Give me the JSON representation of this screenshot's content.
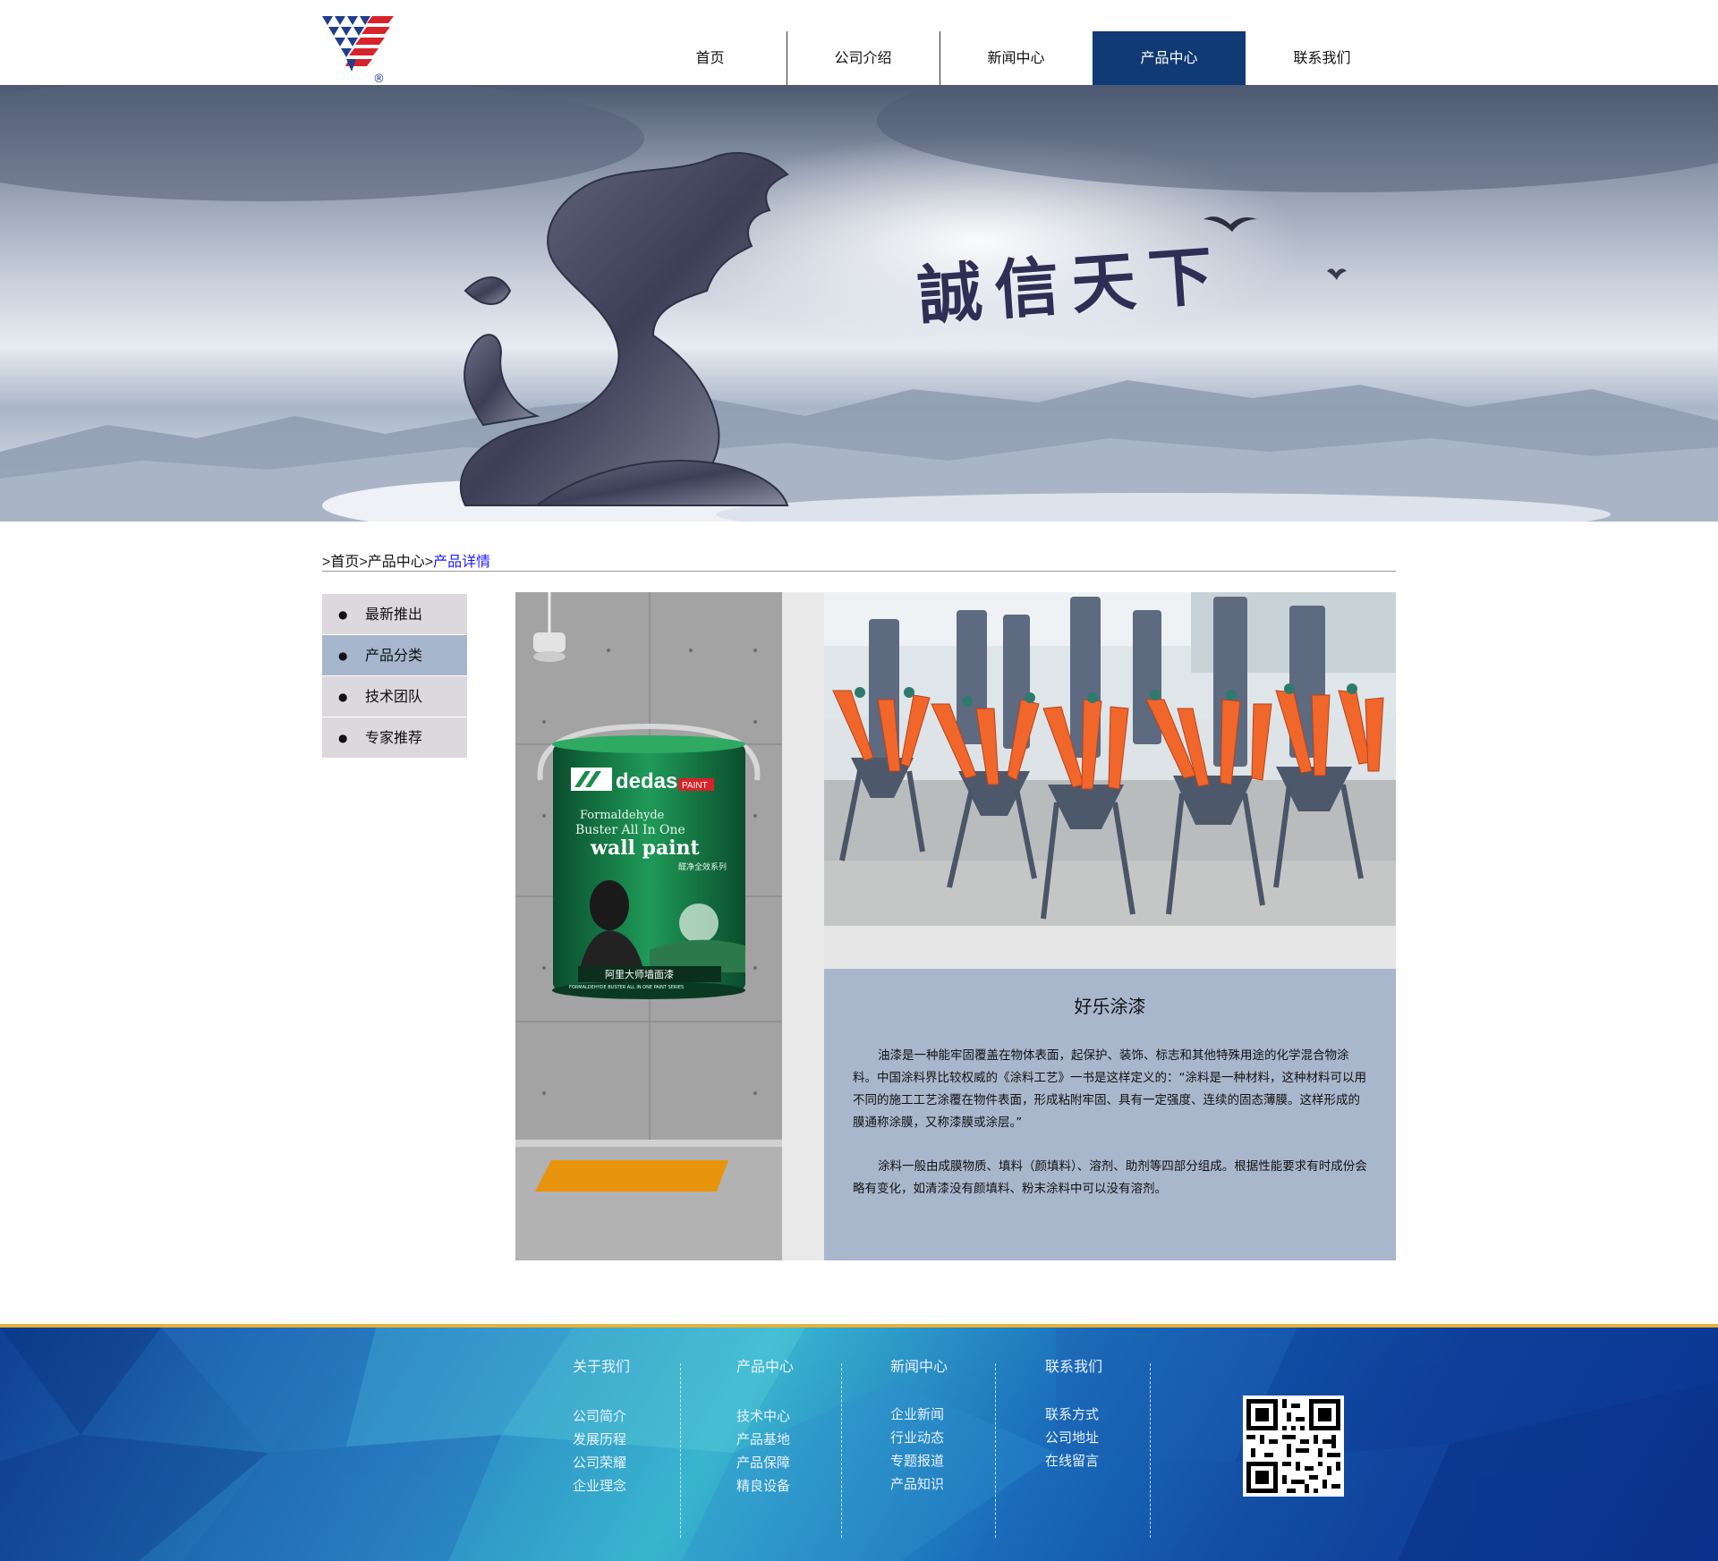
{
  "header": {
    "logo_mark": "®",
    "nav": [
      {
        "label": "首页",
        "active": false
      },
      {
        "label": "公司介绍",
        "active": false
      },
      {
        "label": "新闻中心",
        "active": false
      },
      {
        "label": "产品中心",
        "active": true
      },
      {
        "label": "联系我们",
        "active": false
      }
    ]
  },
  "banner": {
    "slogan": "誠信天下"
  },
  "breadcrumb": {
    "items": [
      "首页",
      "产品中心",
      "产品详情"
    ],
    "separator": ">"
  },
  "sidebar": {
    "items": [
      {
        "label": "最新推出",
        "active": false
      },
      {
        "label": "产品分类",
        "active": true
      },
      {
        "label": "技术团队",
        "active": false
      },
      {
        "label": "专家推荐",
        "active": false
      }
    ]
  },
  "product_image": {
    "brand": "dedas",
    "brand_sub": "PAINT",
    "line1": "Formaldehyde",
    "line2": "Buster All In One",
    "line3": "wall paint",
    "cn_line": "醛净全效系列",
    "bottom_cn": "阿里大师墙面漆",
    "bottom_en": "FORMALDEHYDE BUSTER ALL IN ONE PAINT SERIES"
  },
  "description": {
    "title": "好乐涂漆",
    "paragraphs": [
      "油漆是一种能牢固覆盖在物体表面，起保护、装饰、标志和其他特殊用途的化学混合物涂料。中国涂料界比较权威的《涂料工艺》一书是这样定义的：“涂料是一种材料，这种材料可以用不同的施工工艺涂覆在物件表面，形成粘附牢固、具有一定强度、连续的固态薄膜。这样形成的膜通称涂膜，又称漆膜或涂层。”",
      "涂料一般由成膜物质、填料（颜填料）、溶剂、助剂等四部分组成。根据性能要求有时成份会略有变化，如清漆没有颜填料、粉末涂料中可以没有溶剂。"
    ]
  },
  "footer": {
    "columns": [
      {
        "title": "关于我们",
        "links": [
          "公司简介",
          "发展历程",
          "公司荣耀",
          "企业理念"
        ]
      },
      {
        "title": "产品中心",
        "links": [
          "技术中心",
          "产品基地",
          "产品保障",
          "精良设备"
        ]
      },
      {
        "title": "新闻中心",
        "links": [
          "企业新闻",
          "行业动态",
          "专题报道",
          "产品知识"
        ]
      },
      {
        "title": "联系我们",
        "links": [
          "联系方式",
          "公司地址",
          "在线留言"
        ]
      }
    ]
  },
  "colors": {
    "nav_active": "#0f3a73",
    "sidebar_active": "#a6b6cd",
    "sidebar_bg": "#dcd8de",
    "desc_bg": "#a9b7cd",
    "footer_accent": "#e5b23c",
    "breadcrumb_current": "#1a1aff"
  }
}
